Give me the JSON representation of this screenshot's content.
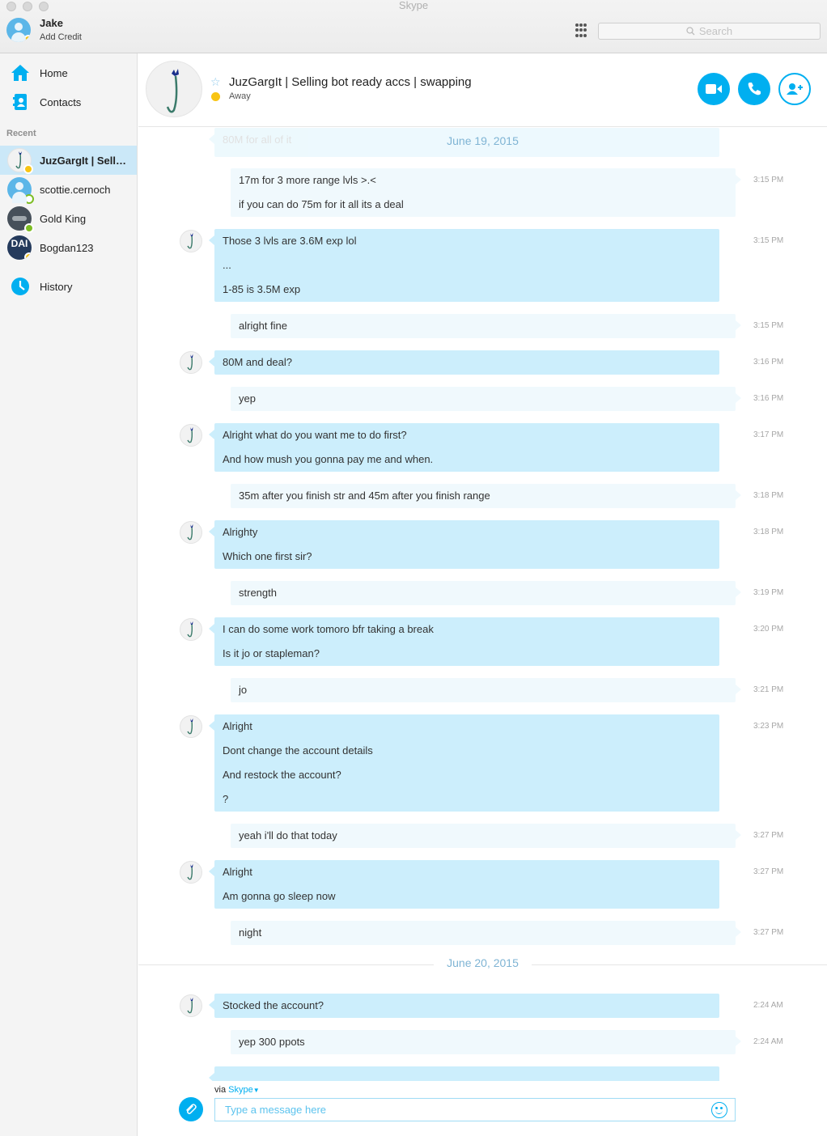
{
  "app_title": "Skype",
  "user": {
    "name": "Jake",
    "credit_label": "Add Credit"
  },
  "search": {
    "placeholder": "Search"
  },
  "nav": {
    "home": "Home",
    "contacts": "Contacts",
    "history": "History"
  },
  "recent": {
    "label": "Recent",
    "items": [
      {
        "name": "JuzGargIt | Selli...",
        "status": "away",
        "active": true
      },
      {
        "name": "scottie.cernoch",
        "status": "offline"
      },
      {
        "name": "Gold King",
        "status": "online"
      },
      {
        "name": "Bogdan123",
        "status": "away",
        "avatar_text": "DAI"
      }
    ]
  },
  "chat": {
    "title": "JuzGargIt | Selling bot ready accs | swapping",
    "status": "Away",
    "faded_text": "80M for all of it"
  },
  "dates": {
    "d1": "June 19, 2015",
    "d2": "June 20, 2015"
  },
  "messages": [
    {
      "dir": "out",
      "lines": [
        "17m for 3 more range lvls >.<",
        "if you can do 75m for it all its a deal"
      ],
      "time": "3:15 PM"
    },
    {
      "dir": "in",
      "lines": [
        "Those 3 lvls are 3.6M exp lol",
        "...",
        "1-85 is 3.5M exp"
      ],
      "time": "3:15 PM"
    },
    {
      "dir": "out",
      "lines": [
        "alright fine"
      ],
      "time": "3:15 PM"
    },
    {
      "dir": "in",
      "lines": [
        "80M and deal?"
      ],
      "time": "3:16 PM"
    },
    {
      "dir": "out",
      "lines": [
        "yep"
      ],
      "time": "3:16 PM"
    },
    {
      "dir": "in",
      "lines": [
        "Alright what do you want me to do first?",
        "And how mush you gonna pay me and when."
      ],
      "time": "3:17 PM"
    },
    {
      "dir": "out",
      "lines": [
        "35m after you finish str and 45m after you finish range"
      ],
      "time": "3:18 PM"
    },
    {
      "dir": "in",
      "lines": [
        "Alrighty",
        "Which one first sir?"
      ],
      "time": "3:18 PM"
    },
    {
      "dir": "out",
      "lines": [
        "strength"
      ],
      "time": "3:19 PM"
    },
    {
      "dir": "in",
      "lines": [
        "I can do some work tomoro bfr taking a break",
        "Is it jo or stapleman?"
      ],
      "time": "3:20 PM"
    },
    {
      "dir": "out",
      "lines": [
        "jo"
      ],
      "time": "3:21 PM"
    },
    {
      "dir": "in",
      "lines": [
        "Alright",
        "Dont change the account details",
        "And restock the account?",
        "?"
      ],
      "time": "3:23 PM"
    },
    {
      "dir": "out",
      "lines": [
        "yeah i'll do that today"
      ],
      "time": "3:27 PM"
    },
    {
      "dir": "in",
      "lines": [
        "Alright",
        "Am gonna go sleep now"
      ],
      "time": "3:27 PM"
    },
    {
      "dir": "out",
      "lines": [
        "night"
      ],
      "time": "3:27 PM"
    },
    {
      "dir": "in",
      "lines": [
        "Stocked the account?"
      ],
      "time": "2:24 AM"
    },
    {
      "dir": "out",
      "lines": [
        "yep 300 ppots"
      ],
      "time": "2:24 AM"
    }
  ],
  "composer": {
    "via_label": "via",
    "via_service": "Skype",
    "placeholder": "Type a message here"
  },
  "colors": {
    "accent": "#00aff0",
    "incoming_bubble": "#cceefc",
    "outgoing_bubble": "#f0f9fd",
    "away": "#f8c414",
    "online": "#7dbd23"
  }
}
